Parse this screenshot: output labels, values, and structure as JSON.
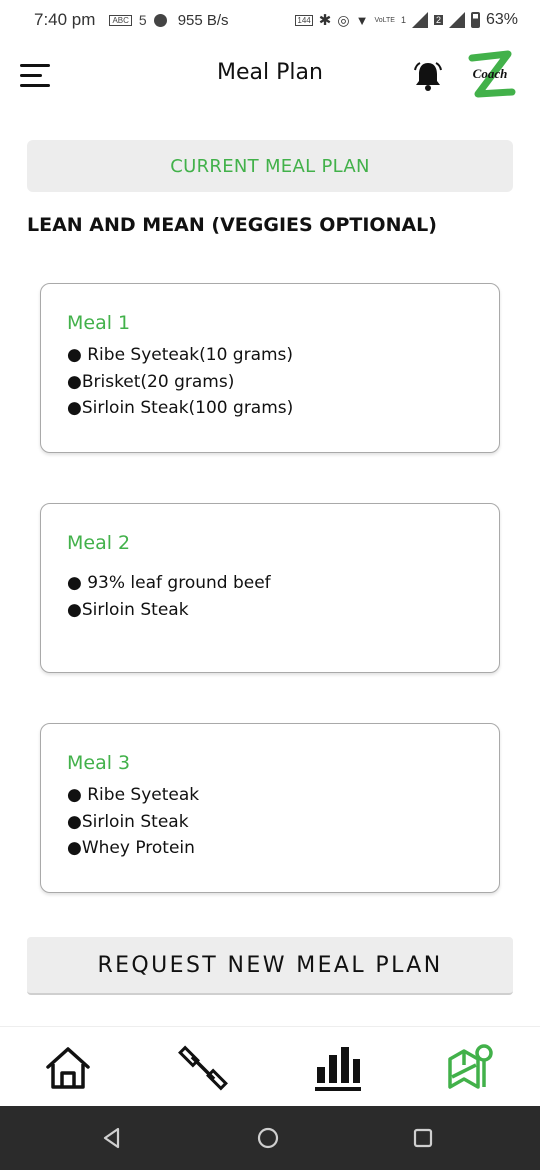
{
  "status_bar": {
    "time": "7:40 pm",
    "speed": "955 B/s",
    "battery": "63%",
    "mini_labels": [
      "ABC",
      "5",
      "144",
      "VoLTE",
      "1",
      "2"
    ],
    "battery_level": 0.63
  },
  "header": {
    "title": "Meal Plan",
    "logo_text": "Coach",
    "icons": {
      "menu": "hamburger-menu-icon",
      "bell": "notification-bell-icon",
      "logo": "coach-z-logo"
    }
  },
  "section": {
    "current_label": "CURRENT MEAL PLAN",
    "plan_name": "LEAN AND MEAN (VEGGIES OPTIONAL)"
  },
  "meals": [
    {
      "title": "Meal 1",
      "items": [
        "● Ribe Syeteak(10 grams)",
        "●Brisket(20 grams)",
        "●Sirloin Steak(100 grams)"
      ]
    },
    {
      "title": "Meal 2",
      "items": [
        "● 93% leaf ground beef",
        "●Sirloin Steak"
      ]
    },
    {
      "title": "Meal 3",
      "items": [
        "● Ribe Syeteak",
        "●Sirloin Steak",
        "●Whey Protein"
      ]
    }
  ],
  "request_button": "REQUEST NEW MEAL PLAN",
  "tabs": [
    {
      "name": "home",
      "icon": "home-icon",
      "active": false
    },
    {
      "name": "workout",
      "icon": "dumbbell-icon",
      "active": false
    },
    {
      "name": "stats",
      "icon": "bar-chart-icon",
      "active": false
    },
    {
      "name": "meal-plan",
      "icon": "meal-map-icon",
      "active": true
    }
  ],
  "colors": {
    "accent": "#42b14a",
    "text": "#111111",
    "panel": "#ededed",
    "nav_bar": "#2b2b2b"
  }
}
